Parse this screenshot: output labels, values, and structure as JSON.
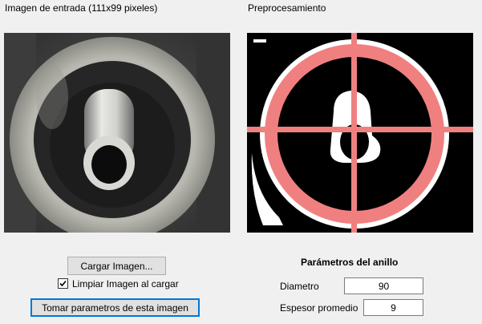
{
  "input_section": {
    "title": "Imagen de entrada (111x99 pixeles)"
  },
  "preprocess_section": {
    "title": "Preprocesamiento"
  },
  "controls": {
    "load_button": "Cargar Imagen...",
    "clear_checkbox_label": "Limpiar Imagen al cargar",
    "clear_checkbox_checked": true,
    "take_params_button": "Tomar parametros de esta imagen"
  },
  "ring_params": {
    "title": "Parámetros del anillo",
    "diameter_label": "Diametro",
    "diameter_value": "90",
    "thickness_label": "Espesor promedio",
    "thickness_value": "9"
  },
  "colors": {
    "ring_overlay": "#f08080",
    "window_bg": "#f0f0f0",
    "default_button_border": "#0078d7"
  }
}
